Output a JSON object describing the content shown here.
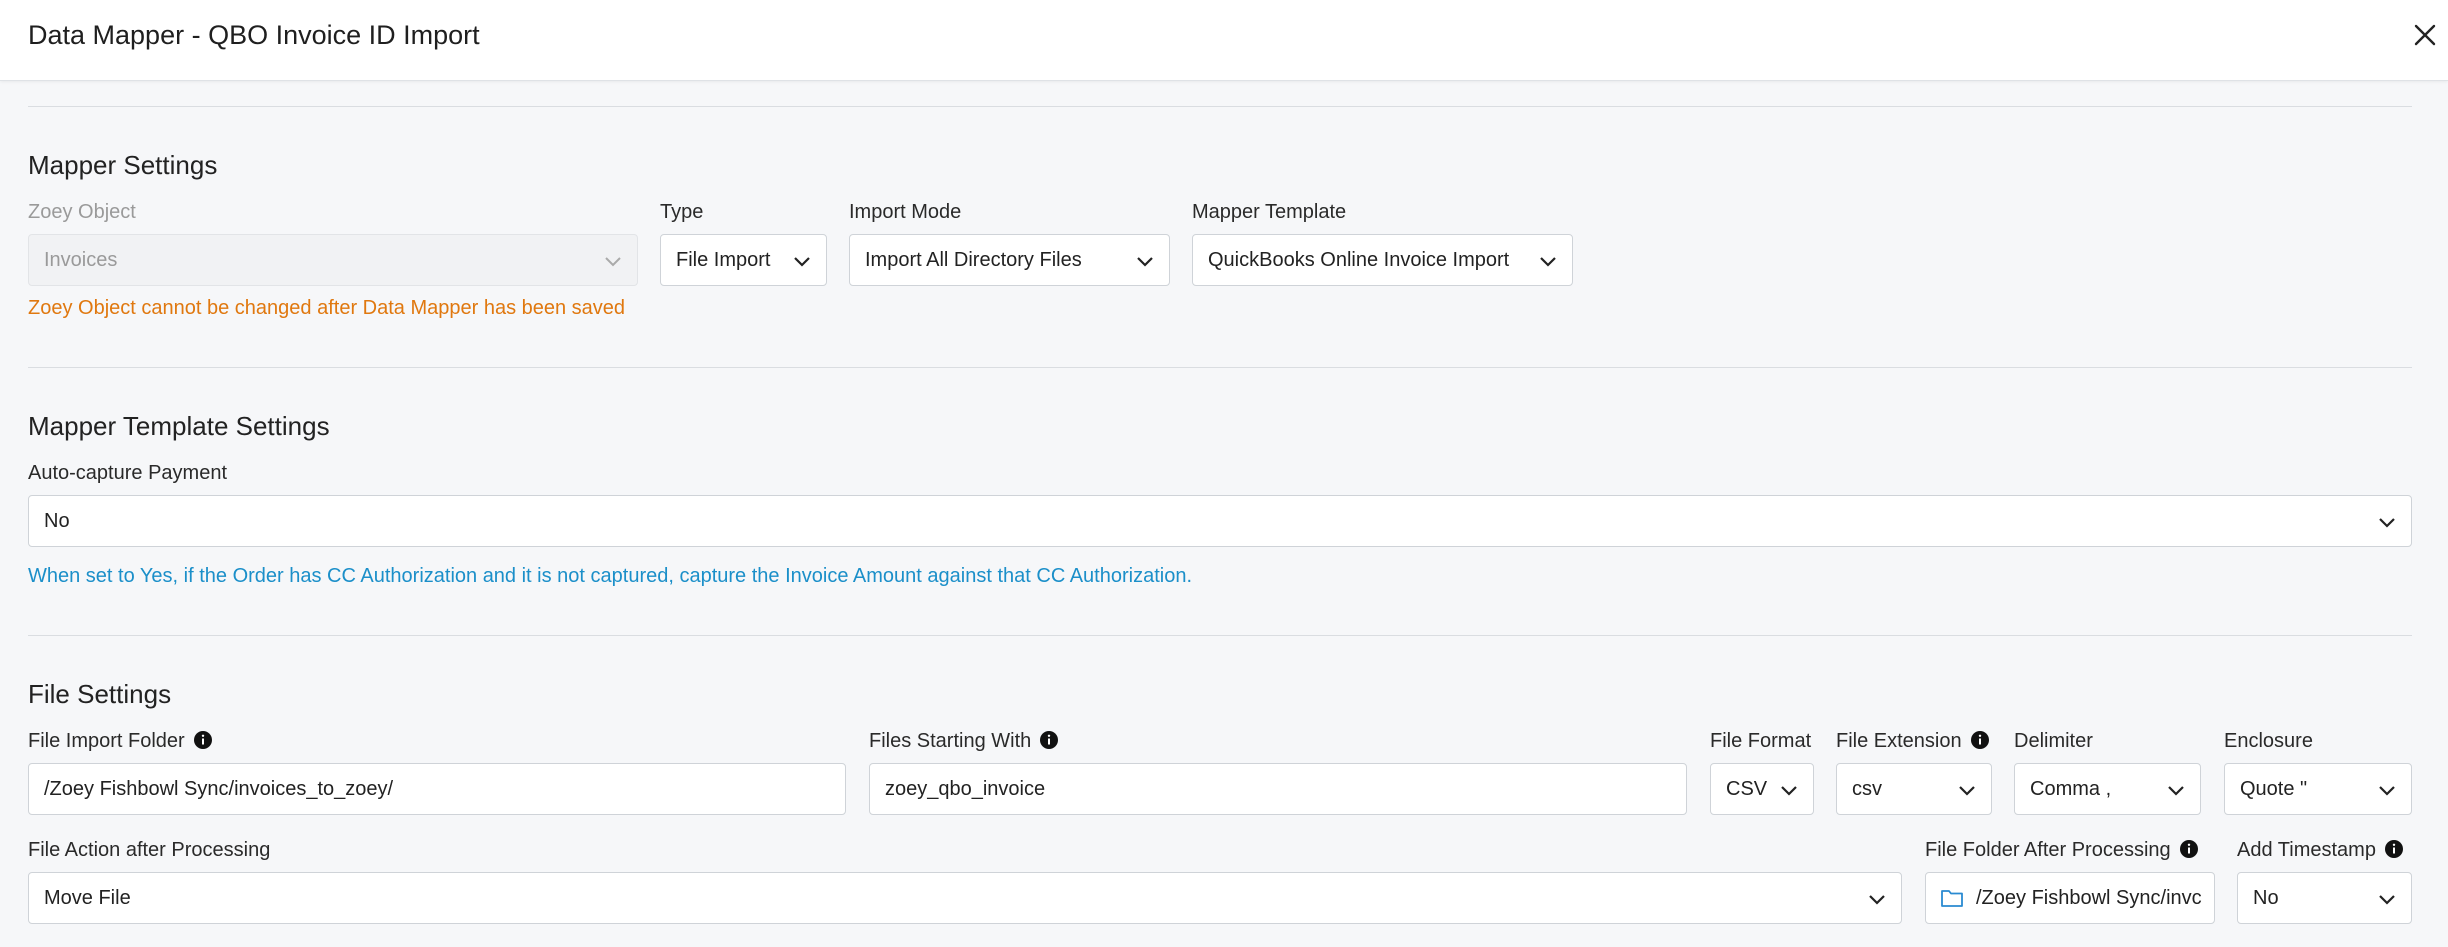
{
  "window": {
    "title": "Data Mapper - QBO Invoice ID Import"
  },
  "colors": {
    "warning": "#e0780f",
    "hint": "#1b8fc9",
    "folder_icon": "#2a8ad1"
  },
  "mapper_settings": {
    "heading": "Mapper Settings",
    "zoey_object": {
      "label": "Zoey Object",
      "value": "Invoices",
      "disabled": true
    },
    "type": {
      "label": "Type",
      "value": "File Import"
    },
    "import_mode": {
      "label": "Import Mode",
      "value": "Import All Directory Files"
    },
    "mapper_template": {
      "label": "Mapper Template",
      "value": "QuickBooks Online Invoice Import"
    },
    "warning": "Zoey Object cannot be changed after Data Mapper has been saved"
  },
  "template_settings": {
    "heading": "Mapper Template Settings",
    "auto_capture": {
      "label": "Auto-capture Payment",
      "value": "No"
    },
    "hint": "When set to Yes, if the Order has CC Authorization and it is not captured, capture the Invoice Amount against that CC Authorization."
  },
  "file_settings": {
    "heading": "File Settings",
    "import_folder": {
      "label": "File Import Folder",
      "value": "/Zoey Fishbowl Sync/invoices_to_zoey/"
    },
    "files_starting": {
      "label": "Files Starting With",
      "value": "zoey_qbo_invoice"
    },
    "file_format": {
      "label": "File Format",
      "value": "CSV"
    },
    "file_extension": {
      "label": "File Extension",
      "value": "csv"
    },
    "delimiter": {
      "label": "Delimiter",
      "value": "Comma ,"
    },
    "enclosure": {
      "label": "Enclosure",
      "value": "Quote \""
    },
    "action_after": {
      "label": "File Action after Processing",
      "value": "Move File"
    },
    "folder_after": {
      "label": "File Folder After Processing",
      "value": "/Zoey Fishbowl Sync/invc"
    },
    "add_timestamp": {
      "label": "Add Timestamp",
      "value": "No"
    }
  }
}
